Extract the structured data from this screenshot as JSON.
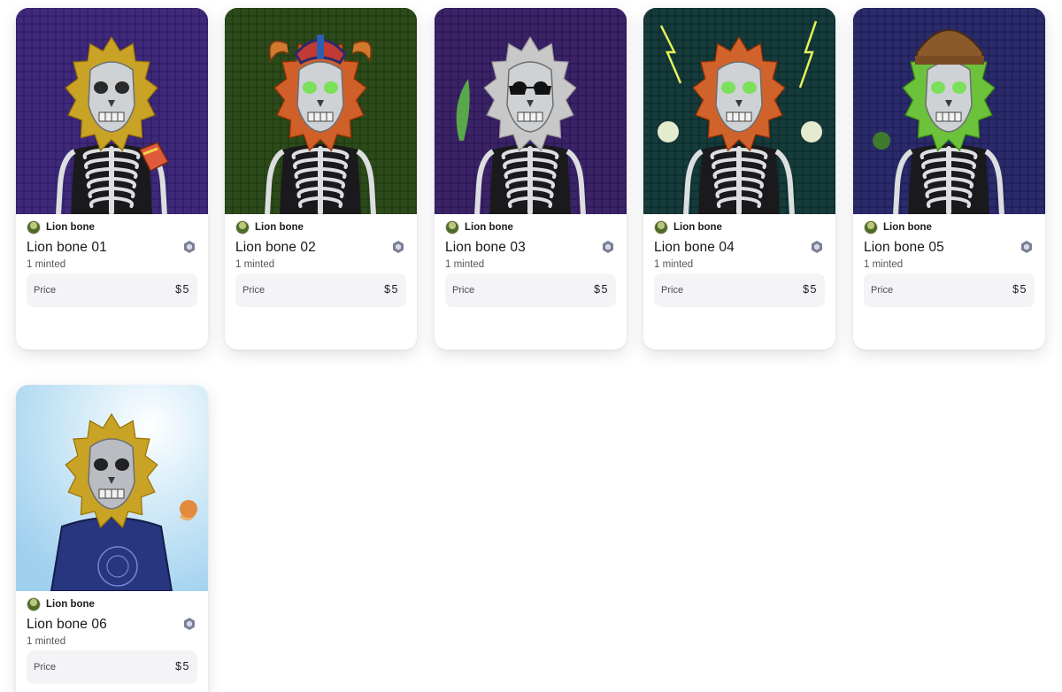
{
  "cards": [
    {
      "creator": "Lion bone",
      "title": "Lion bone 01",
      "minted": "1 minted",
      "price_label": "Price",
      "price_value": "$5",
      "icons": {
        "avatar": "creator-avatar",
        "badge": "hexagon-chain-icon"
      },
      "art": {
        "bg": "#3f2a7a",
        "mane": "#c9a326",
        "skull": "#cfd2d4",
        "eyes": "#2a2a2a",
        "accessory": "held-food"
      }
    },
    {
      "creator": "Lion bone",
      "title": "Lion bone 02",
      "minted": "1 minted",
      "price_label": "Price",
      "price_value": "$5",
      "icons": {
        "avatar": "creator-avatar",
        "badge": "hexagon-chain-icon"
      },
      "art": {
        "bg": "#2d4a1c",
        "mane": "#d0602a",
        "skull": "#cfd2d4",
        "eyes": "#7be05a",
        "accessory": "horned-helmet"
      }
    },
    {
      "creator": "Lion bone",
      "title": "Lion bone 03",
      "minted": "1 minted",
      "price_label": "Price",
      "price_value": "$5",
      "icons": {
        "avatar": "creator-avatar",
        "badge": "hexagon-chain-icon"
      },
      "art": {
        "bg": "#3b2466",
        "mane": "#c8c8c8",
        "skull": "#cfd2d4",
        "eyes": "#111111",
        "accessory": "sunglasses"
      }
    },
    {
      "creator": "Lion bone",
      "title": "Lion bone 04",
      "minted": "1 minted",
      "price_label": "Price",
      "price_value": "$5",
      "icons": {
        "avatar": "creator-avatar",
        "badge": "hexagon-chain-icon"
      },
      "art": {
        "bg": "#173a3a",
        "mane": "#d0622b",
        "skull": "#cfd2d4",
        "eyes": "#7be05a",
        "accessory": "lightning"
      }
    },
    {
      "creator": "Lion bone",
      "title": "Lion bone 05",
      "minted": "1 minted",
      "price_label": "Price",
      "price_value": "$5",
      "icons": {
        "avatar": "creator-avatar",
        "badge": "hexagon-chain-icon"
      },
      "art": {
        "bg": "#2c2b6a",
        "mane": "#6cc23a",
        "skull": "#cfd2d4",
        "eyes": "#7be05a",
        "accessory": "beanie"
      }
    },
    {
      "creator": "Lion bone",
      "title": "Lion bone 06",
      "minted": "1 minted",
      "price_label": "Price",
      "price_value": "$5",
      "icons": {
        "avatar": "creator-avatar",
        "badge": "hexagon-chain-icon"
      },
      "art": {
        "bg": "#9fd0ee",
        "mane": "#c9a326",
        "skull": "#b9bcc0",
        "eyes": "#222222",
        "accessory": "robe"
      }
    }
  ]
}
